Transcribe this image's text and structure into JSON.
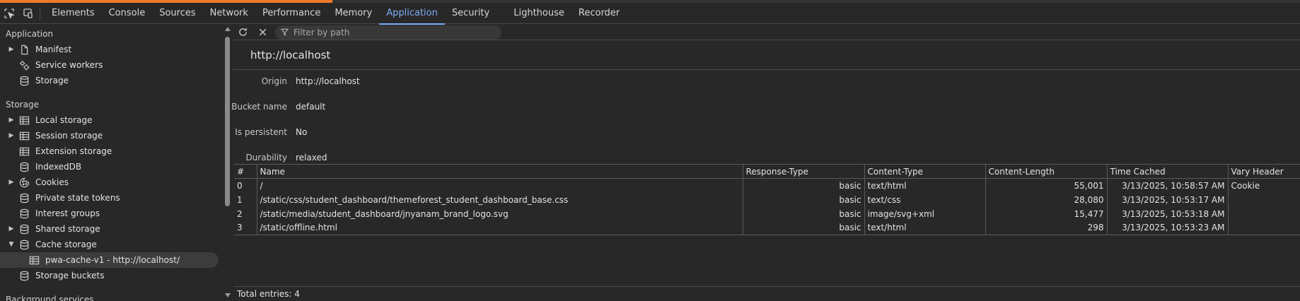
{
  "tabs": {
    "items": [
      "Elements",
      "Console",
      "Sources",
      "Network",
      "Performance",
      "Memory",
      "Application",
      "Security",
      "Lighthouse",
      "Recorder"
    ],
    "active": "Application"
  },
  "sidebar": {
    "application_title": "Application",
    "application_items": [
      {
        "label": "Manifest",
        "icon": "document-icon",
        "expandable": true
      },
      {
        "label": "Service workers",
        "icon": "gears-icon",
        "expandable": false
      },
      {
        "label": "Storage",
        "icon": "database-icon",
        "expandable": false
      }
    ],
    "storage_title": "Storage",
    "storage_items": [
      {
        "label": "Local storage",
        "icon": "table-icon",
        "expandable": true
      },
      {
        "label": "Session storage",
        "icon": "table-icon",
        "expandable": true
      },
      {
        "label": "Extension storage",
        "icon": "table-icon",
        "expandable": false
      },
      {
        "label": "IndexedDB",
        "icon": "database-icon",
        "expandable": false
      },
      {
        "label": "Cookies",
        "icon": "cookie-icon",
        "expandable": true
      },
      {
        "label": "Private state tokens",
        "icon": "database-icon",
        "expandable": false
      },
      {
        "label": "Interest groups",
        "icon": "database-icon",
        "expandable": false
      },
      {
        "label": "Shared storage",
        "icon": "database-icon",
        "expandable": true
      },
      {
        "label": "Cache storage",
        "icon": "database-icon",
        "expanded": true
      },
      {
        "label": "pwa-cache-v1 - http://localhost/",
        "icon": "table-icon",
        "child": true,
        "selected": true
      },
      {
        "label": "Storage buckets",
        "icon": "database-icon",
        "expandable": false
      }
    ],
    "background_title": "Background services"
  },
  "toolbar": {
    "filter_placeholder": "Filter by path"
  },
  "cache": {
    "origin_title": "http://localhost",
    "fields": [
      {
        "key": "Origin",
        "value": "http://localhost"
      },
      {
        "key": "Bucket name",
        "value": "default"
      },
      {
        "key": "Is persistent",
        "value": "No"
      },
      {
        "key": "Durability",
        "value": "relaxed"
      }
    ],
    "columns": [
      "#",
      "Name",
      "Response-Type",
      "Content-Type",
      "Content-Length",
      "Time Cached",
      "Vary Header"
    ],
    "rows": [
      [
        "0",
        "/",
        "basic",
        "text/html",
        "55,001",
        "3/13/2025, 10:58:57 AM",
        "Cookie"
      ],
      [
        "1",
        "/static/css/student_dashboard/themeforest_student_dashboard_base.css",
        "basic",
        "text/css",
        "28,080",
        "3/13/2025, 10:53:17 AM",
        ""
      ],
      [
        "2",
        "/static/media/student_dashboard/jnyanam_brand_logo.svg",
        "basic",
        "image/svg+xml",
        "15,477",
        "3/13/2025, 10:53:18 AM",
        ""
      ],
      [
        "3",
        "/static/offline.html",
        "basic",
        "text/html",
        "298",
        "3/13/2025, 10:53:23 AM",
        ""
      ]
    ],
    "total_entries": "Total entries: 4"
  }
}
